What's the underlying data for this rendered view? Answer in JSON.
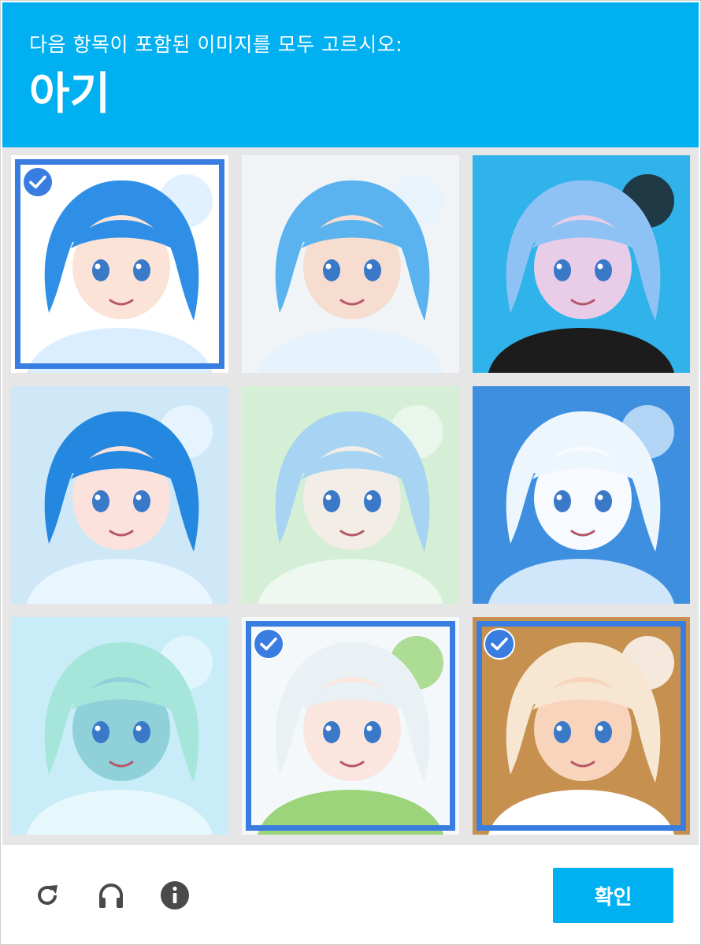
{
  "header": {
    "instruction": "다음 항목이 포함된 이미지를 모두 고르시오:",
    "target": "아기"
  },
  "tiles": [
    {
      "id": "1",
      "selected": true,
      "bg": "#ffffff",
      "hair": "#2f8fe6",
      "skin": "#fbe3d8",
      "accent": "#dbeeff"
    },
    {
      "id": "2",
      "selected": false,
      "bg": "#f1f4f7",
      "hair": "#5ab2ee",
      "skin": "#f6ddd0",
      "accent": "#e6f3fc"
    },
    {
      "id": "3",
      "selected": false,
      "bg": "#2fb3ea",
      "hair": "#8fc2f4",
      "skin": "#e9cde8",
      "accent": "#1c1c1c"
    },
    {
      "id": "4",
      "selected": false,
      "bg": "#cfe8f8",
      "hair": "#2488e0",
      "skin": "#fbe2dc",
      "accent": "#eaf6ff"
    },
    {
      "id": "5",
      "selected": false,
      "bg": "#d4efd6",
      "hair": "#a6d4f2",
      "skin": "#f2ede6",
      "accent": "#eef8f0"
    },
    {
      "id": "6",
      "selected": false,
      "bg": "#3f8fe0",
      "hair": "#eef6fd",
      "skin": "#f7fbff",
      "accent": "#cfe6fb"
    },
    {
      "id": "7",
      "selected": false,
      "bg": "#c8ecf8",
      "hair": "#a6e6da",
      "skin": "#8fd0d9",
      "accent": "#e6f8fc"
    },
    {
      "id": "8",
      "selected": true,
      "bg": "#f4f8fb",
      "hair": "#eaf1f4",
      "skin": "#fbe5df",
      "accent": "#9bd47a"
    },
    {
      "id": "9",
      "selected": true,
      "bg": "#c6904f",
      "hair": "#f6e6d2",
      "skin": "#f8d4bd",
      "accent": "#ffffff"
    }
  ],
  "footer": {
    "reload_icon": "reload-icon",
    "audio_icon": "headphones-icon",
    "info_icon": "info-icon",
    "verify_label": "확인"
  },
  "colors": {
    "header_bg": "#00b0f0",
    "selection": "#3a7de0",
    "verify_bg": "#00b0f0"
  }
}
